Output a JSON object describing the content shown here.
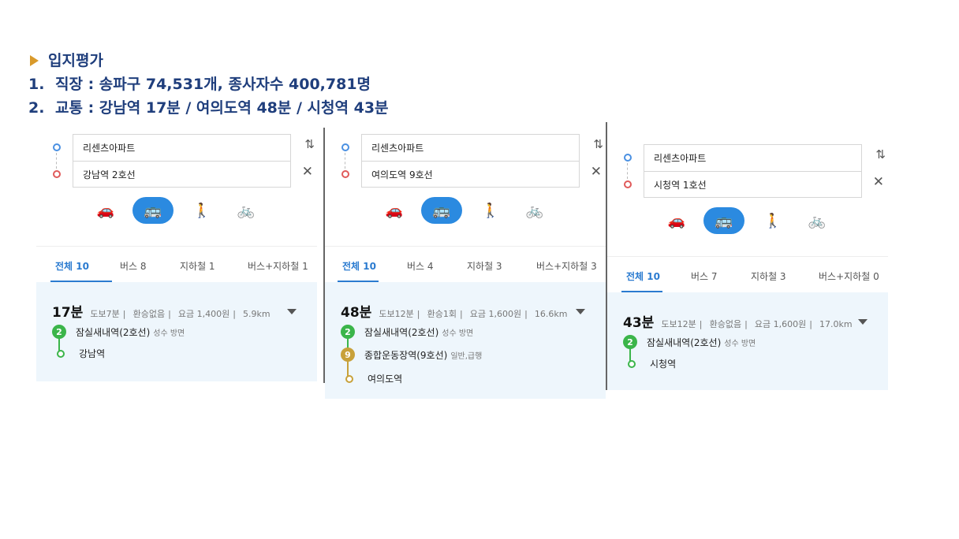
{
  "heading": {
    "title": "입지평가",
    "line1_num": "1.",
    "line1": "직장 : 송파구 74,531개, 종사자수 400,781명",
    "line2_num": "2.",
    "line2": "교통 : 강남역 17분 / 여의도역 48분 / 시청역 43분"
  },
  "colors": {
    "accent": "#2b8ae0",
    "heading": "#1f3e7c",
    "line2": "#3bb54a",
    "line9": "#c8a13a"
  },
  "icons": [
    "car-icon",
    "bus-icon",
    "walk-icon",
    "bike-icon",
    "swap-icon",
    "close-icon",
    "chevron-down-icon"
  ],
  "panels": [
    {
      "origin": "리센츠아파트",
      "destination": "강남역 2호선",
      "tabs": [
        "전체 10",
        "버스 8",
        "지하철 1",
        "버스+지하철 1"
      ],
      "time": "17분",
      "meta": [
        "도보7분",
        "환승없음",
        "요금 1,400원",
        "5.9km"
      ],
      "line_badge": "2",
      "board_station": "잠실새내역(2호선)",
      "board_dir": "성수 방면",
      "dest_station": "강남역"
    },
    {
      "origin": "리센츠아파트",
      "destination": "여의도역 9호선",
      "tabs": [
        "전체 10",
        "버스 4",
        "지하철 3",
        "버스+지하철 3"
      ],
      "time": "48분",
      "meta": [
        "도보12분",
        "환승1회",
        "요금 1,600원",
        "16.6km"
      ],
      "line_badge": "2",
      "board_station": "잠실새내역(2호선)",
      "board_dir": "성수 방면",
      "transfer_badge": "9",
      "transfer_station": "종합운동장역(9호선)",
      "transfer_dir": "일반,급행",
      "dest_station": "여의도역"
    },
    {
      "origin": "리센츠아파트",
      "destination": "시청역 1호선",
      "tabs": [
        "전체 10",
        "버스 7",
        "지하철 3",
        "버스+지하철 0"
      ],
      "time": "43분",
      "meta": [
        "도보12분",
        "환승없음",
        "요금 1,600원",
        "17.0km"
      ],
      "line_badge": "2",
      "board_station": "잠실새내역(2호선)",
      "board_dir": "성수 방면",
      "dest_station": "시청역"
    }
  ]
}
